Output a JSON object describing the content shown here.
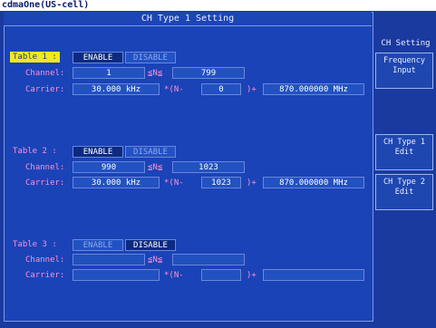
{
  "window_title": "cdmaOne(US-cell)",
  "panel_title": "CH Type 1 Setting",
  "sidebar": {
    "header": "CH Setting",
    "keys": [
      {
        "line1": "Frequency",
        "line2": "Input"
      },
      {
        "line1": "CH Type 1",
        "line2": "Edit"
      },
      {
        "line1": "CH Type 2",
        "line2": "Edit"
      }
    ]
  },
  "labels": {
    "channel": "Channel:",
    "carrier": "Carrier:",
    "enable": "ENABLE",
    "disable": "DISABLE",
    "le": "≦N≦",
    "times": "*(N-",
    "plus": ")+"
  },
  "tables": [
    {
      "title": "Table 1 :",
      "state": "ENABLE",
      "ch_min": "1",
      "ch_max": "799",
      "spacing": "30.000 kHz",
      "offset": "0",
      "base": "870.000000 MHz"
    },
    {
      "title": "Table 2 :",
      "state": "ENABLE",
      "ch_min": "990",
      "ch_max": "1023",
      "spacing": "30.000 kHz",
      "offset": "1023",
      "base": "870.000000 MHz"
    },
    {
      "title": "Table 3 :",
      "state": "DISABLE",
      "ch_min": "",
      "ch_max": "",
      "spacing": "",
      "offset": "",
      "base": ""
    }
  ]
}
